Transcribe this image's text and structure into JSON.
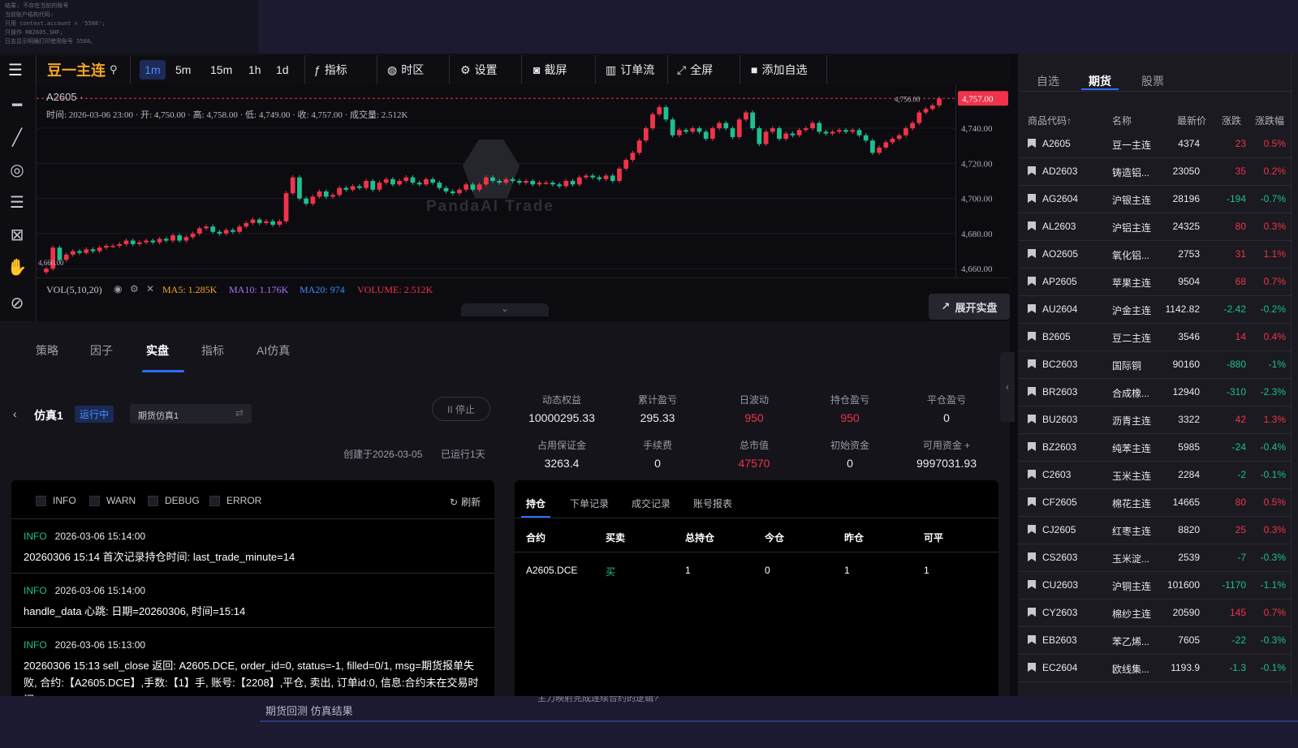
{
  "background": {
    "snippet_lines": [
      "结果: 不存在当前的账号",
      "",
      "当前账户结构代码:",
      "只用 context.account = '5588';",
      "只操作 RB2605.SHF;",
      "日志显示明确打印使用账号 5588。"
    ],
    "bottom_tabs": "期货回测 仿真结果",
    "bottom_hidden_text": "主力映射完成连续合约的逻辑?"
  },
  "toolbar": {
    "symbol": "豆一主连",
    "intervals": [
      "1m",
      "5m",
      "15m",
      "1h",
      "1d"
    ],
    "active_interval": "1m",
    "buttons": {
      "indicator": "指标",
      "timezone": "时区",
      "settings": "设置",
      "screenshot": "截屏",
      "order_flow": "订单流",
      "fullscreen": "全屏",
      "add_watch": "添加自选"
    }
  },
  "chart_data": {
    "type": "candlestick",
    "symbol_label": "A2605 ·",
    "ohlc_line": "时间: 2026-03-06 23:00 · 开: 4,750.00 · 高: 4,758.00 · 低: 4,749.00 · 收: 4,757.00 · 成交量: 2.512K",
    "ylim": [
      4655,
      4765
    ],
    "y_ticks": [
      "4,740.00",
      "4,720.00",
      "4,700.00",
      "4,680.00",
      "4,660.00"
    ],
    "y_tick_values": [
      4740,
      4720,
      4700,
      4680,
      4660
    ],
    "last_price_label": "4,757.00",
    "last_price": 4757,
    "high_marker": "4,756.00",
    "high_marker_value": 4756,
    "low_marker": "4,660.00",
    "low_marker_value": 4660,
    "watermark": "PandaAI Trade",
    "closes": [
      4660,
      4672,
      4665,
      4668,
      4670,
      4669,
      4671,
      4670,
      4672,
      4673,
      4673,
      4674,
      4676,
      4674,
      4675,
      4676,
      4675,
      4677,
      4676,
      4679,
      4676,
      4678,
      4680,
      4683,
      4684,
      4681,
      4680,
      4682,
      4681,
      4684,
      4686,
      4688,
      4686,
      4687,
      4685,
      4687,
      4703,
      4712,
      4700,
      4697,
      4701,
      4704,
      4701,
      4702,
      4706,
      4705,
      4707,
      4706,
      4710,
      4705,
      4709,
      4711,
      4708,
      4710,
      4712,
      4709,
      4708,
      4711,
      4709,
      4706,
      4704,
      4703,
      4705,
      4708,
      4705,
      4708,
      4712,
      4710,
      4709,
      4711,
      4710,
      4709,
      4710,
      4708,
      4709,
      4709,
      4708,
      4707,
      4710,
      4708,
      4712,
      4713,
      4712,
      4711,
      4713,
      4710,
      4717,
      4722,
      4726,
      4733,
      4740,
      4748,
      4752,
      4745,
      4736,
      4739,
      4738,
      4740,
      4738,
      4734,
      4740,
      4743,
      4740,
      4735,
      4745,
      4749,
      4740,
      4731,
      4738,
      4740,
      4734,
      4737,
      4736,
      4739,
      4740,
      4743,
      4738,
      4737,
      4738,
      4739,
      4738,
      4739,
      4736,
      4733,
      4726,
      4729,
      4732,
      4734,
      4736,
      4740,
      4743,
      4749,
      4751,
      4753,
      4757
    ],
    "volume_legend": "VOL(5,10,20)",
    "ma5": "MA5: 1.285K",
    "ma10": "MA10: 1.176K",
    "ma20": "MA20: 974",
    "volume": "VOLUME: 2.512K"
  },
  "expand_live": "展开实盘",
  "panel": {
    "tabs": [
      "策略",
      "因子",
      "实盘",
      "指标",
      "AI仿真"
    ],
    "active_tab": "实盘",
    "account_name": "仿真1",
    "status": "运行中",
    "account_select": "期货仿真1",
    "stop_button": "II 停止",
    "created": "创建于2026-03-05",
    "running": "已运行1天",
    "metrics_row1": [
      {
        "label": "动态权益",
        "value": "10000295.33",
        "color": "white"
      },
      {
        "label": "累计盈亏",
        "value": "295.33",
        "color": "white"
      },
      {
        "label": "日波动",
        "value": "950",
        "color": "red"
      },
      {
        "label": "持仓盈亏",
        "value": "950",
        "color": "red"
      },
      {
        "label": "平仓盈亏",
        "value": "0",
        "color": "white"
      }
    ],
    "metrics_row2": [
      {
        "label": "占用保证金",
        "value": "3263.4",
        "color": "white"
      },
      {
        "label": "手续费",
        "value": "0",
        "color": "white"
      },
      {
        "label": "总市值",
        "value": "47570",
        "color": "red"
      },
      {
        "label": "初始资金",
        "value": "0",
        "color": "white"
      },
      {
        "label": "可用资金 +",
        "value": "9997031.93",
        "color": "white"
      }
    ]
  },
  "logs": {
    "filters": [
      "INFO",
      "WARN",
      "DEBUG",
      "ERROR"
    ],
    "refresh": "刷新",
    "items": [
      {
        "level": "INFO",
        "time": "2026-03-06 15:14:00",
        "message": "20260306 15:14 首次记录持仓时间: last_trade_minute=14"
      },
      {
        "level": "INFO",
        "time": "2026-03-06 15:14:00",
        "message": "handle_data 心跳: 日期=20260306, 时间=15:14"
      },
      {
        "level": "INFO",
        "time": "2026-03-06 15:13:00",
        "message": "20260306 15:13 sell_close 返回: A2605.DCE, order_id=0, status=-1, filled=0/1, msg=期货报单失败, 合约:【A2605.DCE】,手数:【1】手, 账号:【2208】,平仓, 卖出, 订单id:0, 信息:合约未在交易时间"
      }
    ]
  },
  "positions": {
    "tabs": [
      "持仓",
      "下单记录",
      "成交记录",
      "账号报表"
    ],
    "active_tab": "持仓",
    "columns": [
      "合约",
      "买卖",
      "总持仓",
      "今仓",
      "昨仓",
      "可平"
    ],
    "rows": [
      {
        "contract": "A2605.DCE",
        "side": "买",
        "total": "1",
        "today": "0",
        "yesterday": "1",
        "closable": "1"
      }
    ]
  },
  "watchlist": {
    "tabs": [
      "自选",
      "期货",
      "股票"
    ],
    "active_tab": "期货",
    "columns": [
      "商品代码↑",
      "名称",
      "最新价",
      "涨跌",
      "涨跌幅"
    ],
    "rows": [
      {
        "code": "A2605",
        "name": "豆一主连",
        "price": "4374",
        "chg": "23",
        "pct": "0.5%",
        "dir": "up"
      },
      {
        "code": "AD2603",
        "name": "铸造铝...",
        "price": "23050",
        "chg": "35",
        "pct": "0.2%",
        "dir": "up"
      },
      {
        "code": "AG2604",
        "name": "沪银主连",
        "price": "28196",
        "chg": "-194",
        "pct": "-0.7%",
        "dir": "down"
      },
      {
        "code": "AL2603",
        "name": "沪铝主连",
        "price": "24325",
        "chg": "80",
        "pct": "0.3%",
        "dir": "up"
      },
      {
        "code": "AO2605",
        "name": "氧化铝...",
        "price": "2753",
        "chg": "31",
        "pct": "1.1%",
        "dir": "up"
      },
      {
        "code": "AP2605",
        "name": "苹果主连",
        "price": "9504",
        "chg": "68",
        "pct": "0.7%",
        "dir": "up"
      },
      {
        "code": "AU2604",
        "name": "沪金主连",
        "price": "1142.82",
        "chg": "-2.42",
        "pct": "-0.2%",
        "dir": "down"
      },
      {
        "code": "B2605",
        "name": "豆二主连",
        "price": "3546",
        "chg": "14",
        "pct": "0.4%",
        "dir": "up"
      },
      {
        "code": "BC2603",
        "name": "国际铜",
        "price": "90160",
        "chg": "-880",
        "pct": "-1%",
        "dir": "down"
      },
      {
        "code": "BR2603",
        "name": "合成橡...",
        "price": "12940",
        "chg": "-310",
        "pct": "-2.3%",
        "dir": "down"
      },
      {
        "code": "BU2603",
        "name": "沥青主连",
        "price": "3322",
        "chg": "42",
        "pct": "1.3%",
        "dir": "up"
      },
      {
        "code": "BZ2603",
        "name": "纯苯主连",
        "price": "5985",
        "chg": "-24",
        "pct": "-0.4%",
        "dir": "down"
      },
      {
        "code": "C2603",
        "name": "玉米主连",
        "price": "2284",
        "chg": "-2",
        "pct": "-0.1%",
        "dir": "down"
      },
      {
        "code": "CF2605",
        "name": "棉花主连",
        "price": "14665",
        "chg": "80",
        "pct": "0.5%",
        "dir": "up"
      },
      {
        "code": "CJ2605",
        "name": "红枣主连",
        "price": "8820",
        "chg": "25",
        "pct": "0.3%",
        "dir": "up"
      },
      {
        "code": "CS2603",
        "name": "玉米淀...",
        "price": "2539",
        "chg": "-7",
        "pct": "-0.3%",
        "dir": "down"
      },
      {
        "code": "CU2603",
        "name": "沪铜主连",
        "price": "101600",
        "chg": "-1170",
        "pct": "-1.1%",
        "dir": "down"
      },
      {
        "code": "CY2603",
        "name": "棉纱主连",
        "price": "20590",
        "chg": "145",
        "pct": "0.7%",
        "dir": "up"
      },
      {
        "code": "EB2603",
        "name": "苯乙烯...",
        "price": "7605",
        "chg": "-22",
        "pct": "-0.3%",
        "dir": "down"
      },
      {
        "code": "EC2604",
        "name": "欧线集...",
        "price": "1193.9",
        "chg": "-1.3",
        "pct": "-0.1%",
        "dir": "down"
      }
    ]
  },
  "colors": {
    "up": "#f0334a",
    "down": "#1fbf8f",
    "accent": "#2f6bff",
    "symbol": "#f5a623"
  }
}
